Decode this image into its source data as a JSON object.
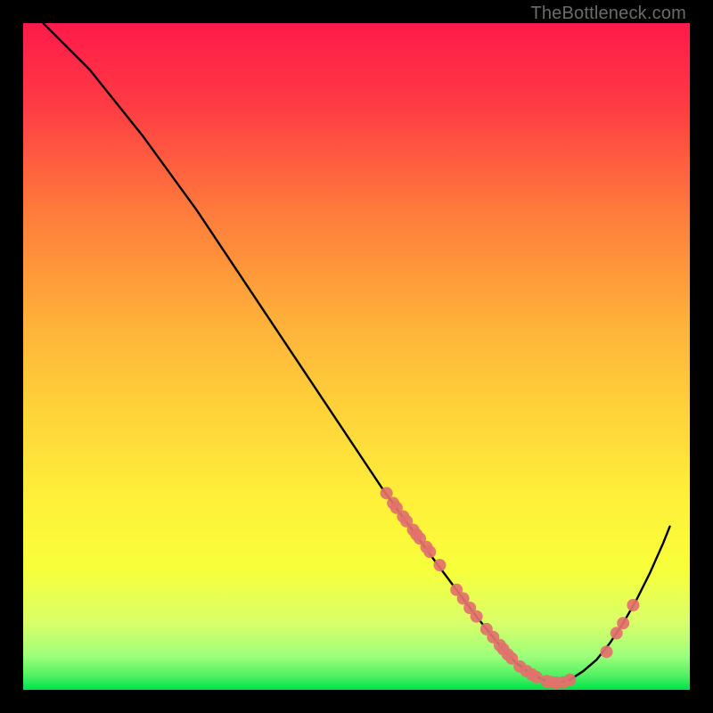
{
  "watermark": "TheBottleneck.com",
  "chart_data": {
    "type": "line",
    "title": "",
    "xlabel": "",
    "ylabel": "",
    "xlim": [
      0,
      100
    ],
    "ylim": [
      0,
      100
    ],
    "background_gradient": {
      "top": "#ff1a4b",
      "mid_upper": "#ff7a3c",
      "mid": "#ffd23a",
      "mid_lower": "#f7ff3a",
      "lower": "#d8ff6a",
      "bottom": "#00e050"
    },
    "series": [
      {
        "name": "bottleneck-curve",
        "color": "#000000",
        "x": [
          3,
          6,
          10,
          14,
          18,
          22,
          26,
          30,
          34,
          38,
          42,
          46,
          50,
          54,
          58,
          62,
          65,
          68,
          70,
          72,
          74,
          76,
          78,
          80,
          82,
          84,
          86,
          88,
          90,
          92,
          94,
          96,
          97
        ],
        "y": [
          100,
          97,
          93,
          88,
          83,
          77.5,
          72,
          66,
          60,
          54,
          48,
          42,
          36,
          30,
          24.5,
          19,
          15,
          11,
          8.5,
          6,
          4,
          2.5,
          1.5,
          1,
          1.5,
          2.8,
          4.5,
          7,
          10,
          13.5,
          17.5,
          22,
          24.5
        ]
      }
    ],
    "scatter_points": {
      "name": "data-points",
      "color": "#e2716d",
      "points": [
        {
          "x": 54.5,
          "y": 29.5
        },
        {
          "x": 55.5,
          "y": 28
        },
        {
          "x": 56,
          "y": 27.3
        },
        {
          "x": 57,
          "y": 26
        },
        {
          "x": 57.5,
          "y": 25.3
        },
        {
          "x": 58.5,
          "y": 24
        },
        {
          "x": 59,
          "y": 23.3
        },
        {
          "x": 59.5,
          "y": 22.7
        },
        {
          "x": 60.5,
          "y": 21.4
        },
        {
          "x": 61,
          "y": 20.7
        },
        {
          "x": 62.5,
          "y": 18.7
        },
        {
          "x": 65,
          "y": 15
        },
        {
          "x": 66,
          "y": 13.7
        },
        {
          "x": 67,
          "y": 12.3
        },
        {
          "x": 68,
          "y": 11
        },
        {
          "x": 69.5,
          "y": 9.1
        },
        {
          "x": 70.5,
          "y": 7.9
        },
        {
          "x": 71.5,
          "y": 6.7
        },
        {
          "x": 72,
          "y": 6.1
        },
        {
          "x": 72.7,
          "y": 5.3
        },
        {
          "x": 73.3,
          "y": 4.7
        },
        {
          "x": 74.5,
          "y": 3.5
        },
        {
          "x": 75.5,
          "y": 2.8
        },
        {
          "x": 76.3,
          "y": 2.3
        },
        {
          "x": 77,
          "y": 1.9
        },
        {
          "x": 78.5,
          "y": 1.3
        },
        {
          "x": 79.2,
          "y": 1.15
        },
        {
          "x": 80,
          "y": 1.05
        },
        {
          "x": 81,
          "y": 1.1
        },
        {
          "x": 82,
          "y": 1.5
        },
        {
          "x": 87.5,
          "y": 5.7
        },
        {
          "x": 89,
          "y": 8.5
        },
        {
          "x": 90,
          "y": 10
        },
        {
          "x": 91.5,
          "y": 12.7
        }
      ]
    }
  }
}
